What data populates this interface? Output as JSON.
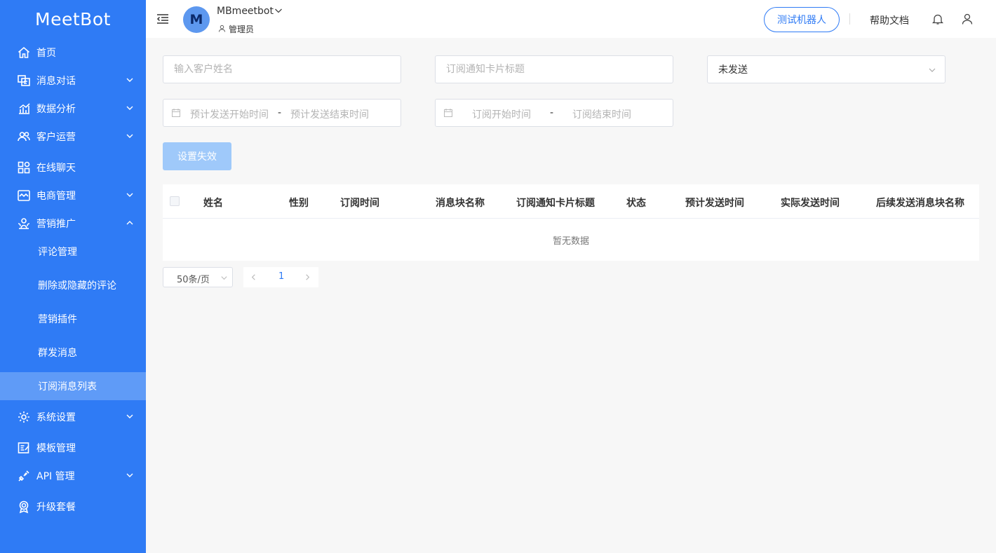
{
  "brand": {
    "logo_text": "MeetBot"
  },
  "sidebar": {
    "items": [
      {
        "label": "首页",
        "icon": "home-icon"
      },
      {
        "label": "消息对话",
        "icon": "chat-icon"
      },
      {
        "label": "数据分析",
        "icon": "analytics-icon"
      },
      {
        "label": "客户运营",
        "icon": "users-icon"
      },
      {
        "label": "在线聊天",
        "icon": "grid-icon"
      },
      {
        "label": "电商管理",
        "icon": "shop-icon"
      },
      {
        "label": "营销推广",
        "icon": "marketing-icon"
      },
      {
        "label": "系统设置",
        "icon": "gear-icon"
      },
      {
        "label": "模板管理",
        "icon": "template-icon"
      },
      {
        "label": "API 管理",
        "icon": "plug-icon"
      },
      {
        "label": "升级套餐",
        "icon": "badge-icon"
      }
    ],
    "subitems": [
      {
        "label": "评论管理"
      },
      {
        "label": "删除或隐藏的评论"
      },
      {
        "label": "营销插件"
      },
      {
        "label": "群发消息"
      },
      {
        "label": "订阅消息列表"
      }
    ],
    "accent_color": "#2f7bf5"
  },
  "header": {
    "account_initial": "M",
    "account_name": "MBmeetbot",
    "role": "管理员",
    "test_bot_label": "测试机器人",
    "help_docs_label": "帮助文档"
  },
  "filters": {
    "customer_name_placeholder": "输入客户姓名",
    "card_title_placeholder": "订阅通知卡片标题",
    "status_value": "未发送",
    "planned_send_start": "预计发送开始时间",
    "planned_send_end": "预计发送结束时间",
    "subscribe_start": "订阅开始时间",
    "subscribe_end": "订阅结束时间",
    "range_separator": "-"
  },
  "actions": {
    "set_invalid_label": "设置失效"
  },
  "table": {
    "columns": [
      "姓名",
      "性别",
      "订阅时间",
      "消息块名称",
      "订阅通知卡片标题",
      "状态",
      "预计发送时间",
      "实际发送时间",
      "后续发送消息块名称"
    ],
    "empty_text": "暂无数据"
  },
  "pagination": {
    "page_size": "50条/页",
    "current_page": "1"
  }
}
